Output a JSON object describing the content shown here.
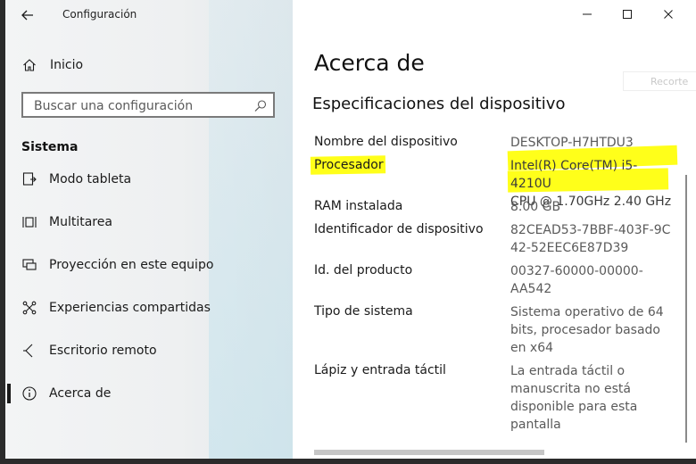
{
  "window": {
    "title": "Configuración",
    "controls": {
      "minimize_icon": "minimize-icon",
      "maximize_icon": "maximize-icon",
      "close_icon": "close-icon"
    }
  },
  "sidebar": {
    "home_label": "Inicio",
    "search": {
      "placeholder": "Buscar una configuración",
      "value": ""
    },
    "section_label": "Sistema",
    "items": [
      {
        "label": "Modo tableta",
        "icon": "tablet-mode-icon"
      },
      {
        "label": "Multitarea",
        "icon": "multitasking-icon"
      },
      {
        "label": "Proyección en este equipo",
        "icon": "projection-icon"
      },
      {
        "label": "Experiencias compartidas",
        "icon": "shared-experiences-icon"
      },
      {
        "label": "Escritorio remoto",
        "icon": "remote-desktop-icon"
      },
      {
        "label": "Acerca de",
        "icon": "info-icon",
        "active": true
      }
    ]
  },
  "main": {
    "title": "Acerca de",
    "ghost_button": "Recorte",
    "section_title": "Especificaciones del dispositivo",
    "specs": [
      {
        "label": "Nombre del dispositivo",
        "value_lines": [
          "DESKTOP-H7HTDU3"
        ]
      },
      {
        "label": "Procesador",
        "value_lines": [
          "Intel(R) Core(TM) i5-4210U",
          "CPU @ 1.70GHz   2.40 GHz"
        ],
        "highlighted": true
      },
      {
        "label": "RAM instalada",
        "value_lines": [
          "8.00 GB"
        ]
      },
      {
        "label": "Identificador de dispositivo",
        "value_lines": [
          "82CEAD53-7BBF-403F-9C",
          "42-52EEC6E87D39"
        ]
      },
      {
        "label": "Id. del producto",
        "value_lines": [
          "00327-60000-00000-",
          "AA542"
        ]
      },
      {
        "label": "Tipo de sistema",
        "value_lines": [
          "Sistema operativo de 64",
          "bits, procesador basado",
          "en x64"
        ]
      },
      {
        "label": "Lápiz y entrada táctil",
        "value_lines": [
          "La entrada táctil o",
          "manuscrita no está",
          "disponible para esta",
          "pantalla"
        ]
      }
    ]
  },
  "colors": {
    "highlight": "#ffff1a",
    "sidebar_bg": "#f1f2f3",
    "accent_blue": "#cfe7ef"
  }
}
